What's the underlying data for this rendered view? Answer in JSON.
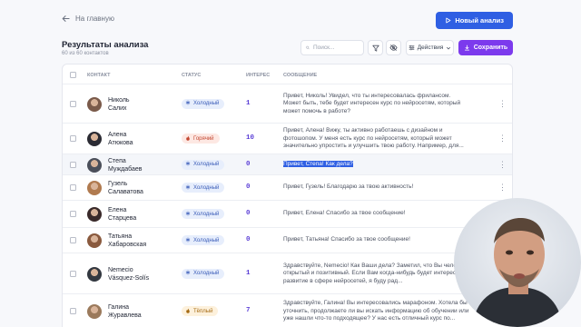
{
  "header": {
    "back_label": "На главную",
    "new_analysis_label": "Новый анализ",
    "title": "Результаты анализа",
    "subtitle": "60 из 60 контактов"
  },
  "toolbar": {
    "search_placeholder": "Поиск...",
    "actions_label": "Действия",
    "save_label": "Сохранить"
  },
  "table": {
    "columns": [
      "КОНТАКТ",
      "СТАТУС",
      "ИНТЕРЕС",
      "СООБЩЕНИЕ"
    ],
    "rows": [
      {
        "first": "Николь",
        "last": "Салих",
        "status": "Холодный",
        "status_type": "cold",
        "status_icon": "snowflake-icon",
        "interest": "1",
        "message": "Привет, Николь! Увидел, что ты интересовалась фрилансом. Может быть, тебе будет интересен курс по нейросетям, который может помочь в работе?"
      },
      {
        "first": "Алена",
        "last": "Атюкова",
        "status": "Горячий",
        "status_type": "hot",
        "status_icon": "flame-icon",
        "interest": "10",
        "message": "Привет, Алена! Вижу, ты активно работаешь с дизайном и фотошопом. У меня есть курс по нейросетям, который может значительно упростить и улучшить твою работу. Например, для..."
      },
      {
        "first": "Степа",
        "last": "Муждабаев",
        "status": "Холодный",
        "status_type": "cold",
        "status_icon": "snowflake-icon",
        "interest": "0",
        "message": "Привет, Степа! Как дела?",
        "selected": true
      },
      {
        "first": "Гузель",
        "last": "Салаватова",
        "status": "Холодный",
        "status_type": "cold",
        "status_icon": "snowflake-icon",
        "interest": "0",
        "message": "Привет, Гузель! Благодарю за твою активность!"
      },
      {
        "first": "Елена",
        "last": "Старцева",
        "status": "Холодный",
        "status_type": "cold",
        "status_icon": "snowflake-icon",
        "interest": "0",
        "message": "Привет, Елена! Спасибо за твое сообщение!"
      },
      {
        "first": "Татьяна",
        "last": "Хабаровская",
        "status": "Холодный",
        "status_type": "cold",
        "status_icon": "snowflake-icon",
        "interest": "0",
        "message": "Привет, Татьяна! Спасибо за твое сообщение!"
      },
      {
        "first": "Nemecio",
        "last": "Vásquez-Solís",
        "status": "Холодный",
        "status_type": "cold",
        "status_icon": "snowflake-icon",
        "interest": "1",
        "message": "Здравствуйте, Nemecio! Как Ваши дела? Заметил, что Вы человек открытый и позитивный. Если Вам когда-нибудь будет интересно развитие в сфере нейросетей, я буду рад..."
      },
      {
        "first": "Галина",
        "last": "Журавлева",
        "status": "Тёплый",
        "status_type": "warm",
        "status_icon": "flame-icon",
        "interest": "7",
        "message": "Здравствуйте, Галина! Вы интересовались марафоном. Хотела бы уточнить, продолжаете ли вы искать информацию об обучении или уже нашли что-то подходящее? У нас есть отличный курс по..."
      }
    ]
  },
  "colors": {
    "primary": "#2f5fe3",
    "save": "#7c3aed",
    "interest": "#5b3fd6"
  }
}
